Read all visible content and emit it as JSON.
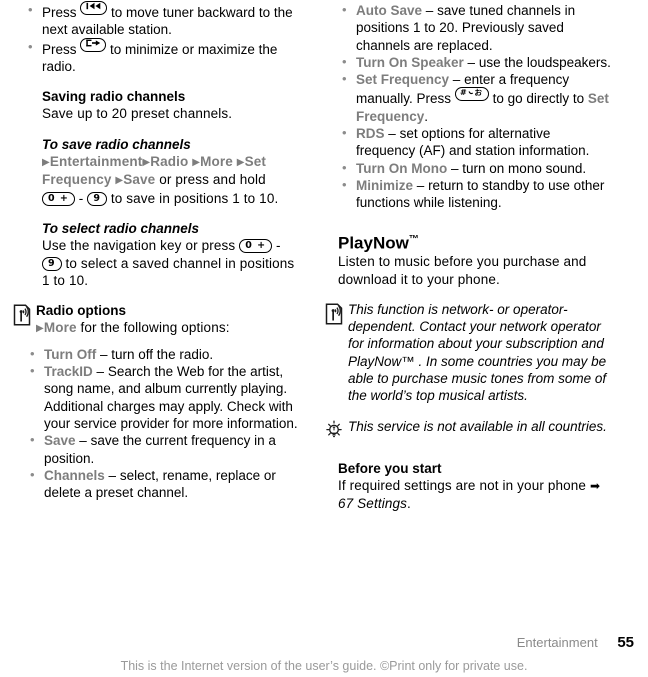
{
  "document": {
    "footer_section": "Entertainment",
    "page_number": "55",
    "copyright_line": "This is the Internet version of the user’s guide. ©Print only for private use."
  },
  "left_column": {
    "intro_bullets": [
      {
        "prefix": "Press",
        "key": "rewind-key",
        "key_label": "⏮",
        "text": "to move tuner backward to the next available station."
      },
      {
        "prefix": "Press",
        "key": "minimize-key",
        "key_label": "↳",
        "text": "to minimize or maximize the radio."
      }
    ],
    "saving_section": {
      "heading": "Saving radio channels",
      "body": "Save up to 20 preset channels."
    },
    "save_subsection": {
      "heading": "To save radio channels",
      "path": [
        "Entertainment",
        "Radio",
        "More",
        "Set Frequency",
        "Save"
      ],
      "after_path": "or press and hold",
      "key_from": "0 +",
      "key_sep": "-",
      "key_to": "9",
      "tail": "to save in positions 1 to 10."
    },
    "select_subsection": {
      "heading": "To select radio channels",
      "lead": "Use the navigation key or press",
      "key_from": "0 +",
      "key_sep": "-",
      "key_to": "9",
      "tail": "to select a saved channel in positions 1 to 10."
    },
    "radio_options": {
      "icon": "radio-signal-icon",
      "heading": "Radio options",
      "path_item": "More",
      "path_tail": "for the following options:",
      "items": [
        {
          "term": "Turn Off",
          "dash": "–",
          "desc": "turn off the radio."
        },
        {
          "term": "TrackID",
          "dash": "–",
          "desc": "Search the Web for the artist, song name, and album currently playing. Additional charges may apply. Check with your service provider for more information."
        },
        {
          "term": "Save",
          "dash": "–",
          "desc": "save the current frequency in a position."
        },
        {
          "term": "Channels",
          "dash": "–",
          "desc": "select, rename, replace or delete a preset channel."
        }
      ]
    }
  },
  "right_column": {
    "options_continued": [
      {
        "term": "Auto Save",
        "dash": "–",
        "desc": "save tuned channels in positions 1 to 20. Previously saved channels are replaced."
      },
      {
        "term": "Turn On Speaker",
        "dash": "–",
        "desc": "use the loudspeakers."
      },
      {
        "term": "Set Frequency",
        "dash": "–",
        "desc_a": "enter a frequency manually. Press",
        "key_label": "#",
        "desc_b": "to go directly to",
        "link": "Set Frequency",
        "desc_c": "."
      },
      {
        "term": "RDS",
        "dash": "–",
        "desc": "set options for alternative frequency (AF) and station information."
      },
      {
        "term": "Turn On Mono",
        "dash": "–",
        "desc": "turn on mono sound."
      },
      {
        "term": "Minimize",
        "dash": "–",
        "desc": "return to standby to use other functions while listening."
      }
    ],
    "playnow": {
      "heading": "PlayNow",
      "trademark": "™",
      "body": "Listen to music before you purchase and download it to your phone."
    },
    "network_note": {
      "icon": "radio-signal-icon",
      "text": "This function is network- or operator-dependent. Contact your network operator for information about your subscription and PlayNow™ . In some countries you may be able to purchase music tones from some of the world’s top musical artists."
    },
    "tip_note": {
      "icon": "lightbulb-tip-icon",
      "text": "This service is not available in all countries."
    },
    "before_you_start": {
      "heading": "Before you start",
      "body_a": "If required settings are not in your phone",
      "arrow": "➡",
      "reference": "67 Settings",
      "body_b": "."
    }
  },
  "colors": {
    "menu_gray": "#7d7d7d",
    "body_black": "#000000",
    "footer_gray": "#8a8a8a"
  }
}
